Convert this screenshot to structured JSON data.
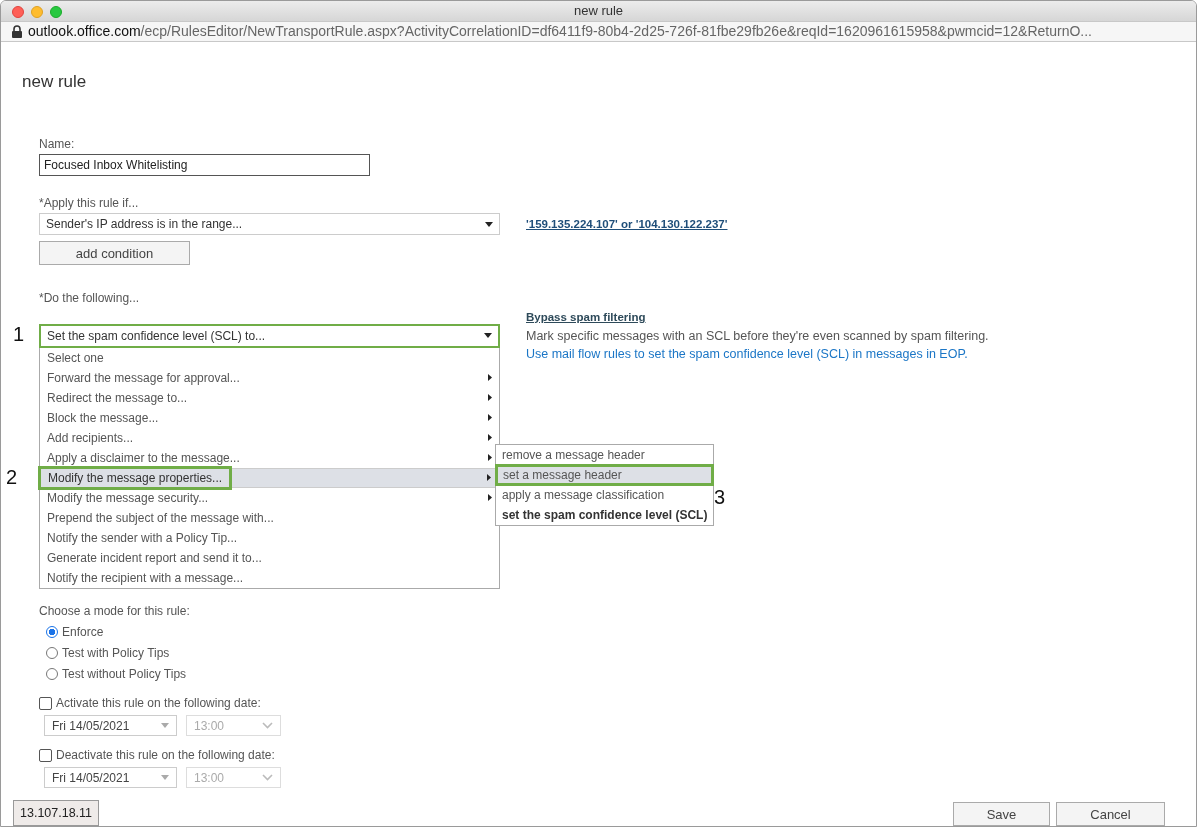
{
  "window": {
    "title": "new rule"
  },
  "address_bar": {
    "host": "outlook.office.com",
    "path": "/ecp/RulesEditor/NewTransportRule.aspx?ActivityCorrelationID=df6411f9-80b4-2d25-726f-81fbe29fb26e&reqId=1620961615958&pwmcid=12&ReturnO..."
  },
  "page": {
    "heading": "new rule"
  },
  "name_field": {
    "label": "Name:",
    "value": "Focused Inbox Whitelisting"
  },
  "condition": {
    "label": "*Apply this rule if...",
    "value": "Sender's IP address is in the range...",
    "link": "'159.135.224.107' or '104.130.122.237'",
    "add_button": "add condition"
  },
  "action": {
    "label": "*Do the following...",
    "value": "Set the spam confidence level (SCL) to...",
    "highlighted": true,
    "callout": "1",
    "link_title": "Bypass spam filtering",
    "description": "Mark specific messages with an SCL before they're even scanned by spam filtering.",
    "help_link": "Use mail flow rules to set the spam confidence level (SCL) in messages in EOP."
  },
  "action_menu": {
    "items": [
      {
        "label": "Select one",
        "has_submenu": false,
        "selected": false,
        "highlighted": false
      },
      {
        "label": "Forward the message for approval...",
        "has_submenu": true,
        "selected": false,
        "highlighted": false
      },
      {
        "label": "Redirect the message to...",
        "has_submenu": true,
        "selected": false,
        "highlighted": false
      },
      {
        "label": "Block the message...",
        "has_submenu": true,
        "selected": false,
        "highlighted": false
      },
      {
        "label": "Add recipients...",
        "has_submenu": true,
        "selected": false,
        "highlighted": false
      },
      {
        "label": "Apply a disclaimer to the message...",
        "has_submenu": true,
        "selected": false,
        "highlighted": false
      },
      {
        "label": "Modify the message properties...",
        "has_submenu": true,
        "selected": true,
        "highlighted": true,
        "callout": "2"
      },
      {
        "label": "Modify the message security...",
        "has_submenu": true,
        "selected": false,
        "highlighted": false
      },
      {
        "label": "Prepend the subject of the message with...",
        "has_submenu": false,
        "selected": false,
        "highlighted": false
      },
      {
        "label": "Notify the sender with a Policy Tip...",
        "has_submenu": false,
        "selected": false,
        "highlighted": false
      },
      {
        "label": "Generate incident report and send it to...",
        "has_submenu": false,
        "selected": false,
        "highlighted": false
      },
      {
        "label": "Notify the recipient with a message...",
        "has_submenu": false,
        "selected": false,
        "highlighted": false
      }
    ]
  },
  "submenu": {
    "items": [
      {
        "label": "remove a message header",
        "selected": false,
        "highlighted": false,
        "current": false
      },
      {
        "label": "set a message header",
        "selected": true,
        "highlighted": true,
        "current": false,
        "callout": "3"
      },
      {
        "label": "apply a message classification",
        "selected": false,
        "highlighted": false,
        "current": false
      },
      {
        "label": "set the spam confidence level (SCL)",
        "selected": false,
        "highlighted": false,
        "current": true
      }
    ]
  },
  "mode": {
    "label": "Choose a mode for this rule:",
    "options": [
      {
        "label": "Enforce",
        "selected": true
      },
      {
        "label": "Test with Policy Tips",
        "selected": false
      },
      {
        "label": "Test without Policy Tips",
        "selected": false
      }
    ]
  },
  "schedule": [
    {
      "label": "Activate this rule on the following date:",
      "checked": false,
      "date": "Fri 14/05/2021",
      "time": "13:00",
      "time_disabled": true
    },
    {
      "label": "Deactivate this rule on the following date:",
      "checked": false,
      "date": "Fri 14/05/2021",
      "time": "13:00",
      "time_disabled": true
    }
  ],
  "buttons": [
    {
      "label": "Save"
    },
    {
      "label": "Cancel"
    }
  ],
  "status_tooltip": "13.107.18.11"
}
